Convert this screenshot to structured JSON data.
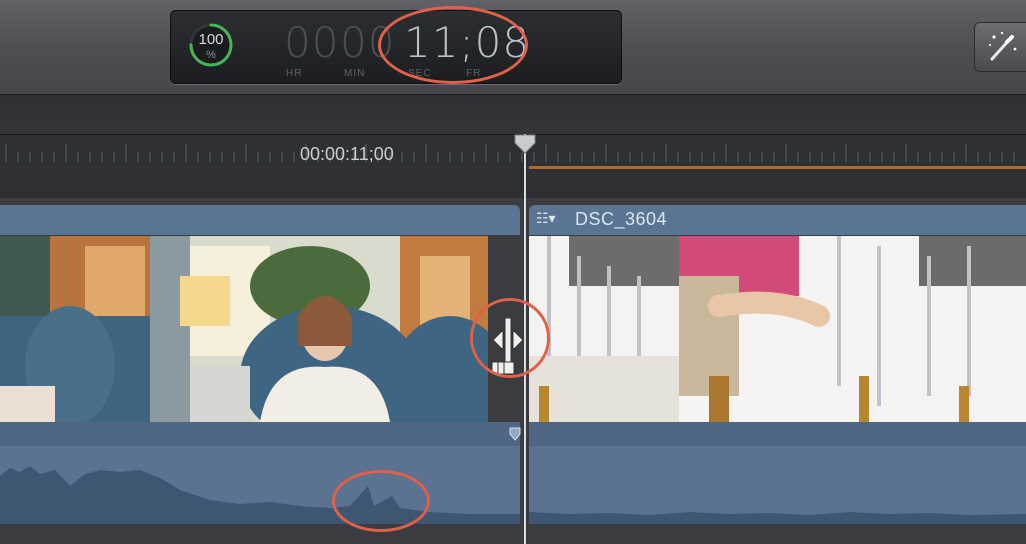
{
  "dashboard": {
    "percent_value": "100",
    "percent_sign": "%",
    "timecode": {
      "hours": "00",
      "minutes": "00",
      "active": "11;08",
      "units": [
        "HR",
        "MIN",
        "SEC",
        "FR"
      ]
    },
    "render_progress": 0.75
  },
  "ruler": {
    "timecode_label": "00:00:11;00"
  },
  "clips": {
    "clip_b_title": "DSC_3604",
    "clip_b_icon": "clip-menu-icon"
  },
  "colors": {
    "clip_header": "#5a7493",
    "annotation_ring": "#e0604a",
    "ruler_render_bar": "#c7752c",
    "percent_ring": "#49b35a"
  }
}
